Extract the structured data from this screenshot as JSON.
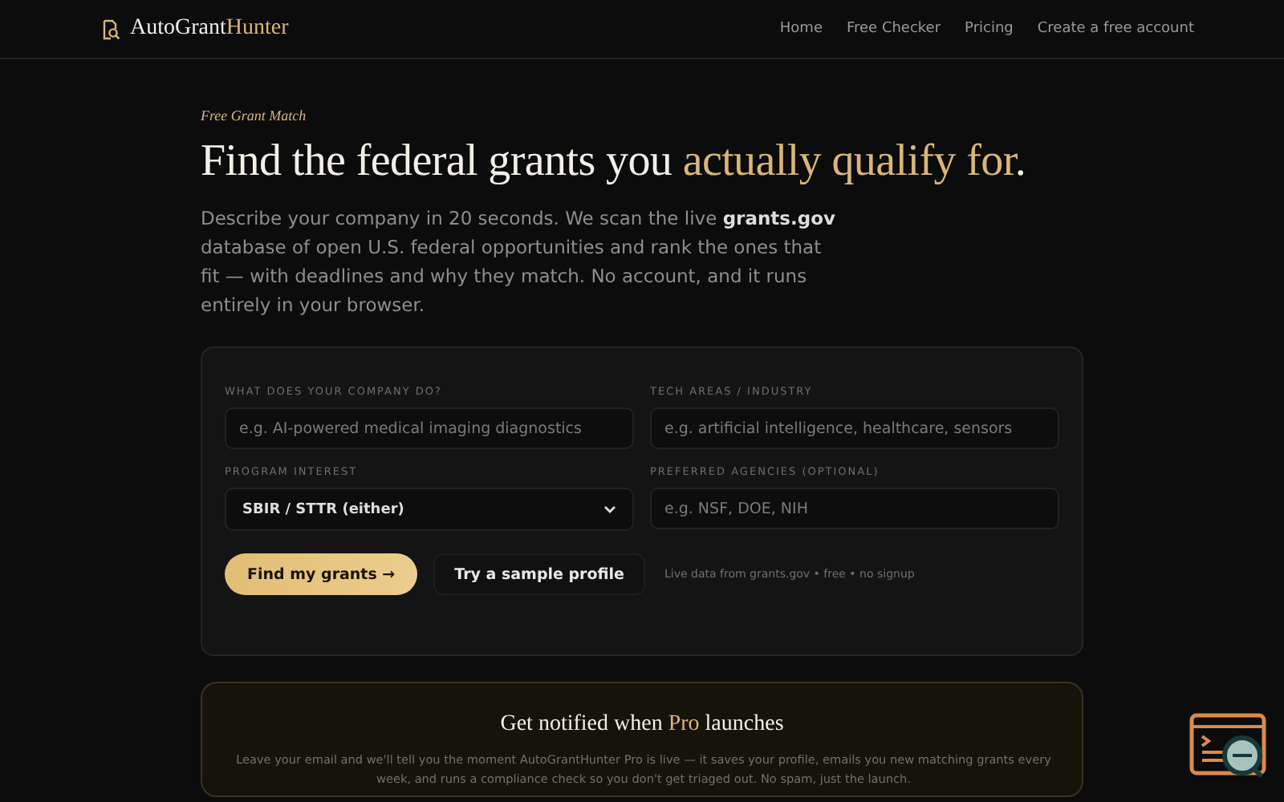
{
  "nav": {
    "brand_main": "AutoGrant",
    "brand_accent": "Hunter",
    "links": [
      "Home",
      "Free Checker",
      "Pricing",
      "Create a free account"
    ]
  },
  "hero": {
    "eyebrow": "Free Grant Match",
    "headline_start": "Find the federal grants you ",
    "headline_accent": "actually qualify for",
    "headline_end": ".",
    "description": "Describe your company in 20 seconds. We scan the live **grants.gov** database of open U.S. federal opportunities and rank the ones that fit — with deadlines and why they match. No account, and it runs entirely in your browser."
  },
  "form": {
    "fields": [
      {
        "kind": "text",
        "label": "WHAT DOES YOUR COMPANY DO?",
        "placeholder": "e.g. AI-powered medical imaging diagnostics"
      },
      {
        "kind": "text",
        "label": "TECH AREAS / INDUSTRY",
        "placeholder": "e.g. artificial intelligence, healthcare, sensors"
      },
      {
        "kind": "select",
        "label": "PROGRAM INTEREST",
        "value": "SBIR / STTR (either)"
      },
      {
        "kind": "text",
        "label": "PREFERRED AGENCIES (OPTIONAL)",
        "placeholder": "e.g. NSF, DOE, NIH"
      }
    ],
    "primary_button": "Find my grants →",
    "secondary_button": "Try a sample profile",
    "note": "Live data from grants.gov • free • no signup"
  },
  "notify": {
    "title_start": "Get notified when ",
    "title_accent": "Pro",
    "title_end": " launches",
    "description": "Leave your email and we'll tell you the moment AutoGrantHunter Pro is live — it saves your profile, emails you new matching grants every week, and runs a compliance check so you don't get triaged out. No spam, just the launch."
  }
}
